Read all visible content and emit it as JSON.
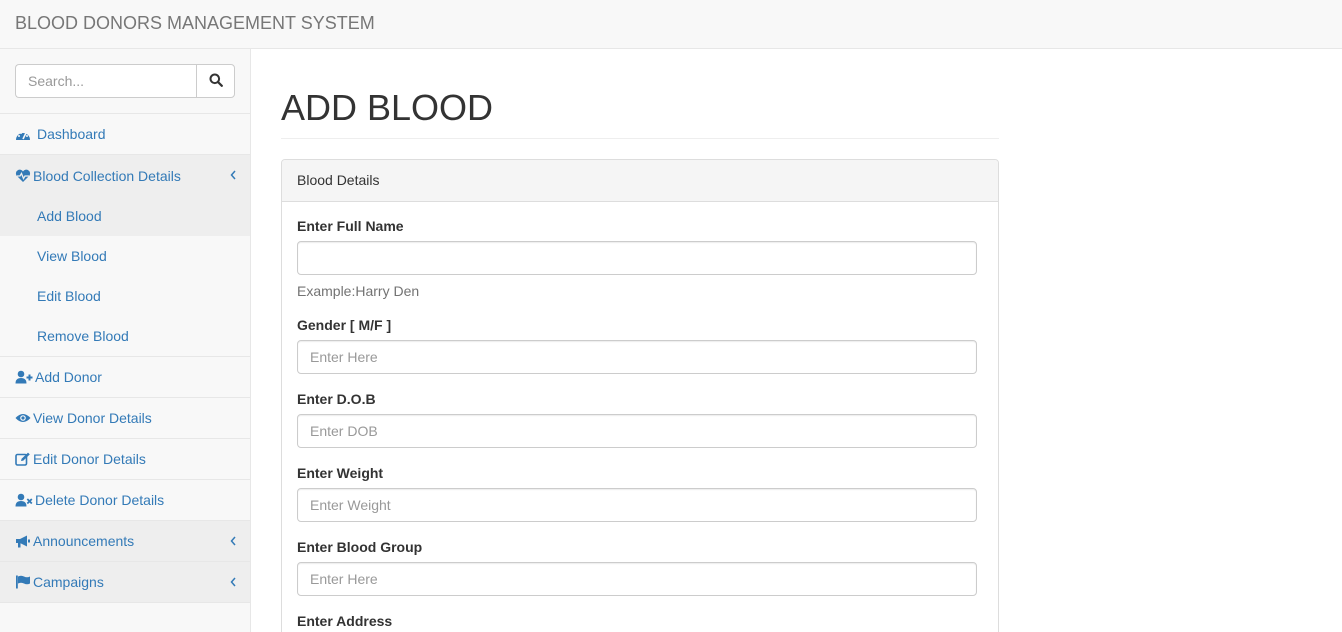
{
  "navbar": {
    "brand": "BLOOD DONORS MANAGEMENT SYSTEM"
  },
  "sidebar": {
    "search": {
      "placeholder": "Search..."
    },
    "items": [
      {
        "label": "Dashboard",
        "icon": "dashboard-icon"
      },
      {
        "label": "Blood Collection Details",
        "icon": "heartbeat-icon",
        "expanded": true,
        "children": [
          {
            "label": "Add Blood",
            "active": true
          },
          {
            "label": "View Blood"
          },
          {
            "label": "Edit Blood"
          },
          {
            "label": "Remove Blood"
          }
        ]
      },
      {
        "label": "Add Donor",
        "icon": "user-plus-icon"
      },
      {
        "label": "View Donor Details",
        "icon": "eye-icon"
      },
      {
        "label": "Edit Donor Details",
        "icon": "edit-icon"
      },
      {
        "label": "Delete Donor Details",
        "icon": "user-times-icon"
      },
      {
        "label": "Announcements",
        "icon": "bullhorn-icon"
      },
      {
        "label": "Campaigns",
        "icon": "flag-icon"
      }
    ]
  },
  "main": {
    "title": "ADD BLOOD",
    "panel": {
      "heading": "Blood Details",
      "fields": [
        {
          "label": "Enter Full Name",
          "value": "",
          "placeholder": "",
          "help": "Example:Harry Den"
        },
        {
          "label": "Gender [ M/F ]",
          "value": "",
          "placeholder": "Enter Here"
        },
        {
          "label": "Enter D.O.B",
          "value": "",
          "placeholder": "Enter DOB"
        },
        {
          "label": "Enter Weight",
          "value": "",
          "placeholder": "Enter Weight"
        },
        {
          "label": "Enter Blood Group",
          "value": "",
          "placeholder": "Enter Here"
        },
        {
          "label": "Enter Address"
        }
      ]
    }
  },
  "colors": {
    "link": "#337ab7",
    "navbar_bg": "#f8f8f8",
    "border": "#e7e7e7"
  }
}
